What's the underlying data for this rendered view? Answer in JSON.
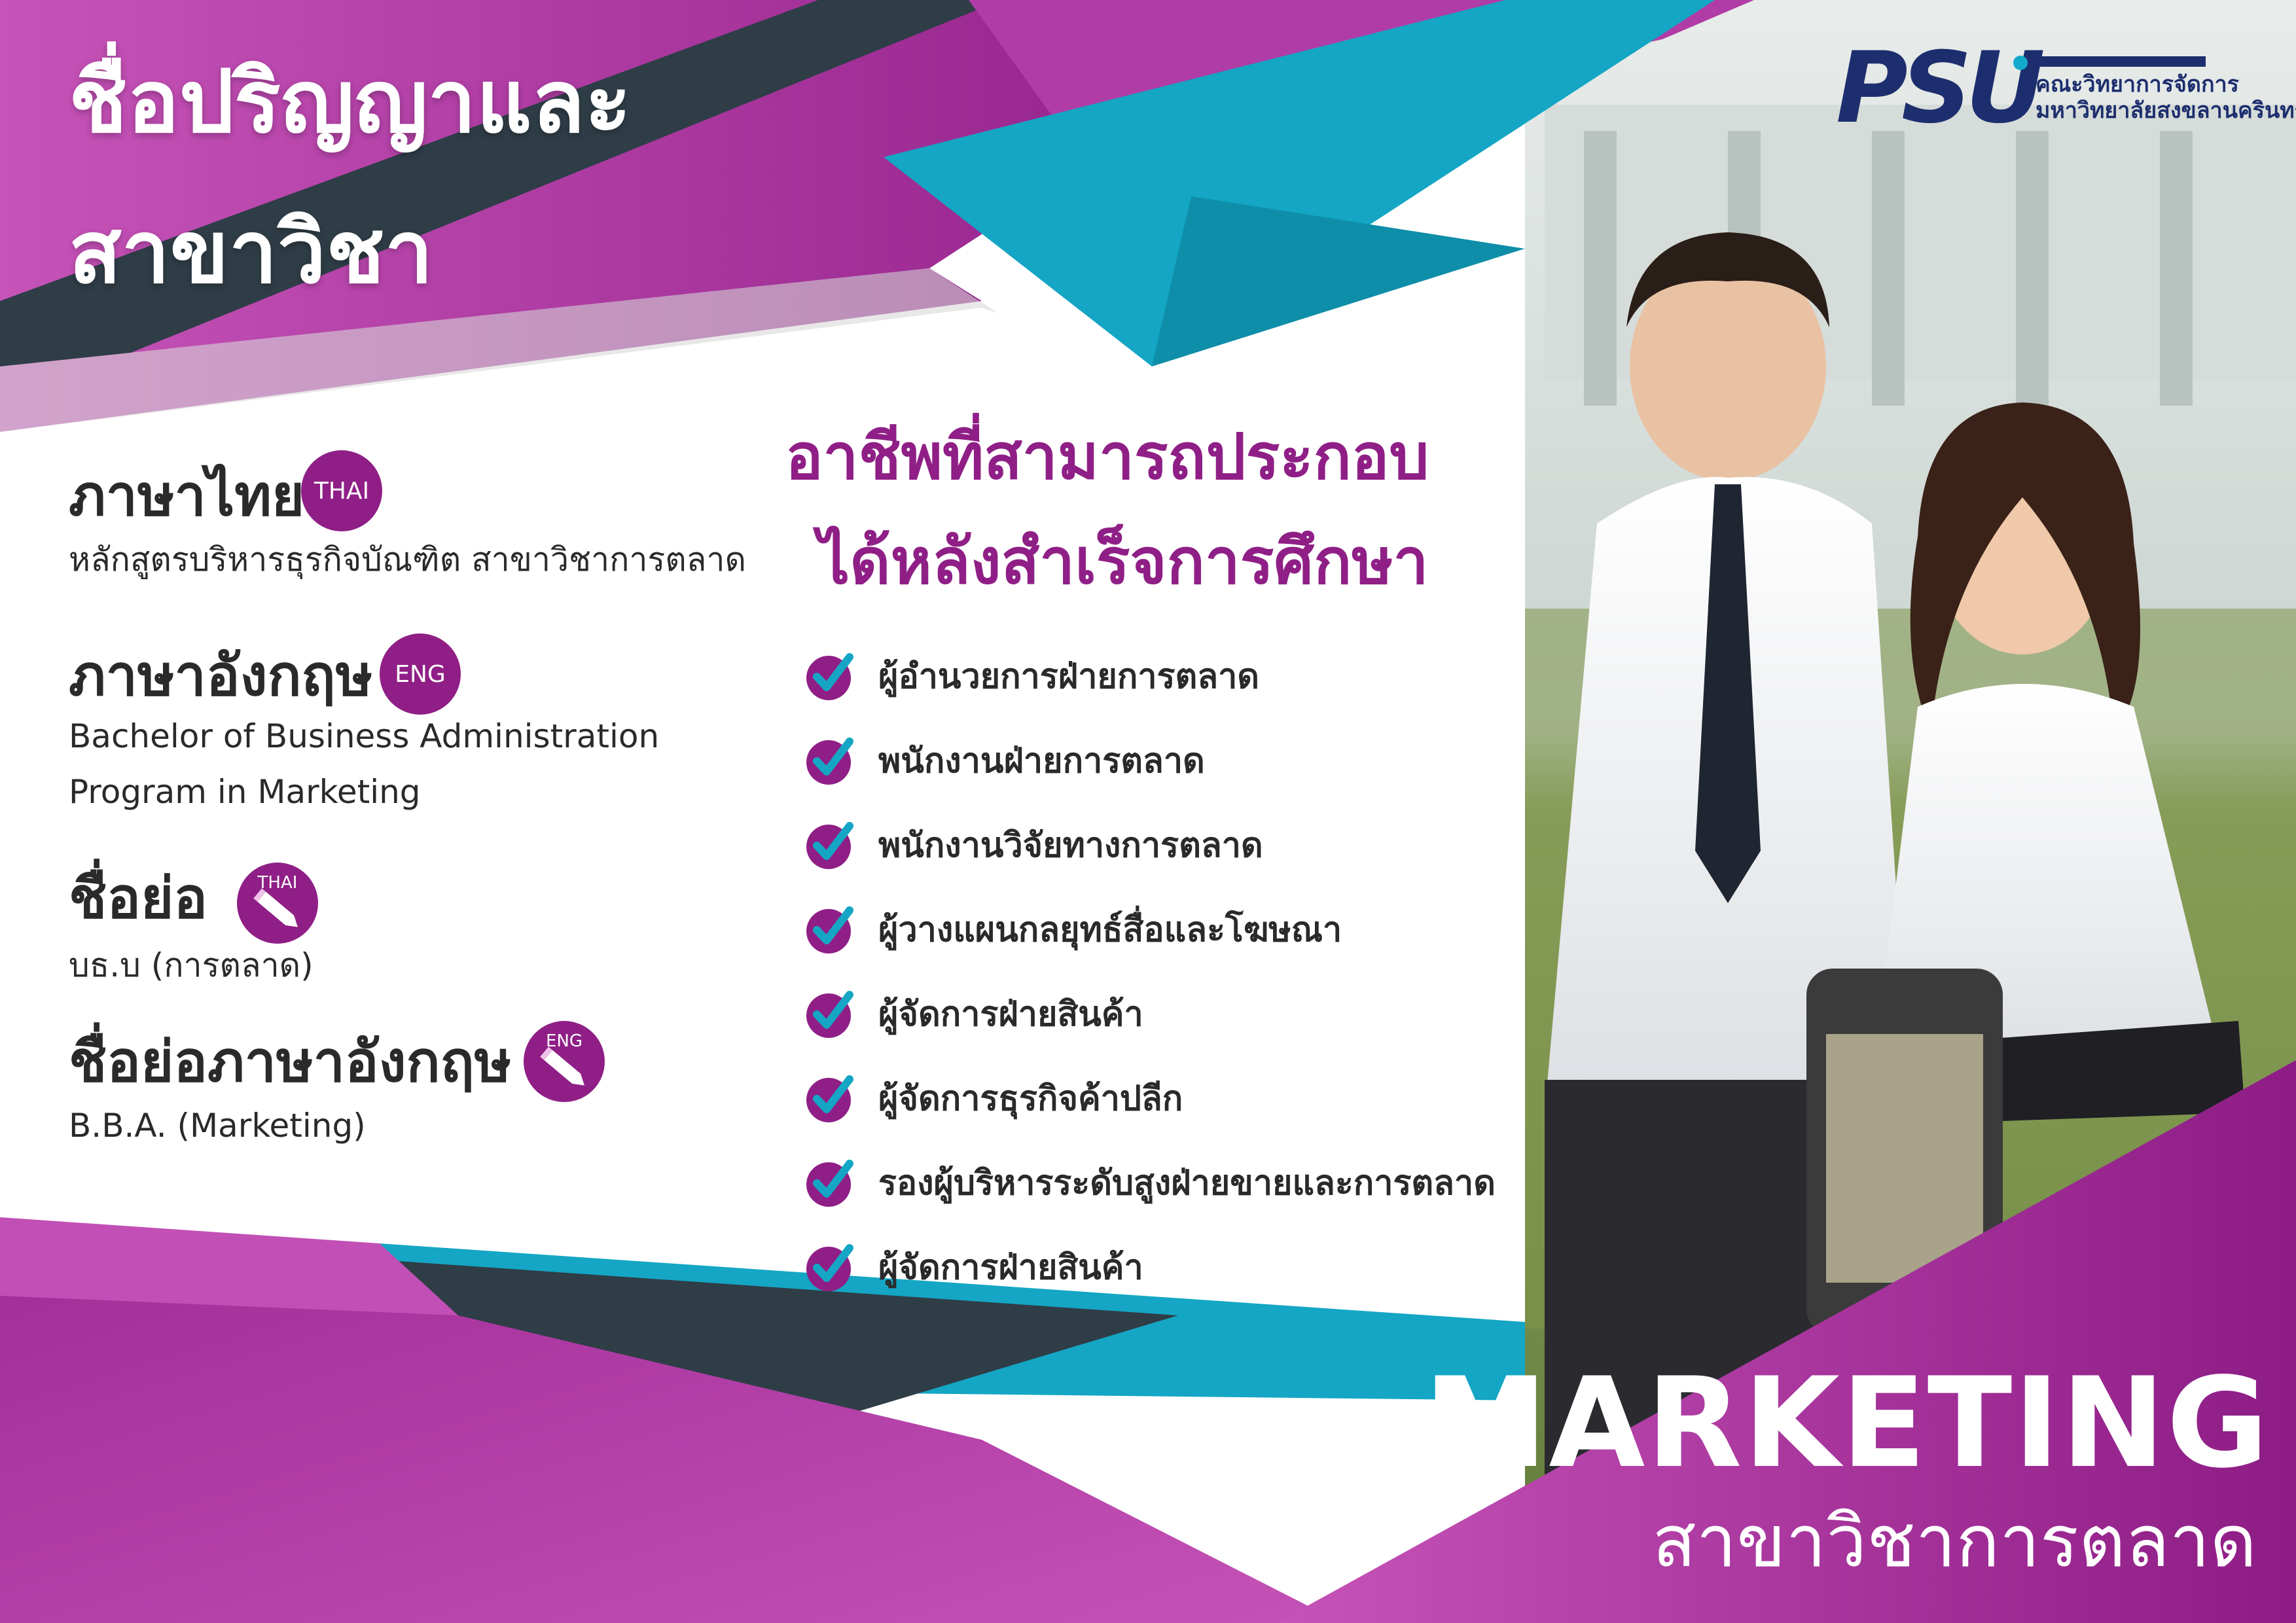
{
  "title": {
    "line1": "ชื่อปริญญาและ",
    "line2": "สาขาวิชา"
  },
  "logo": {
    "mark": "PSU",
    "line1": "คณะวิทยาการจัดการ",
    "line2": "มหาวิทยาลัยสงขลานครินทร์"
  },
  "sections": {
    "thai": {
      "heading": "ภาษาไทย",
      "badge": "THAI",
      "text": "หลักสูตรบริหารธุรกิจบัณฑิต สาขาวิชาการตลาด"
    },
    "eng": {
      "heading": "ภาษาอังกฤษ",
      "badge": "ENG",
      "line1": "Bachelor of Business Administration",
      "line2": "Program in Marketing"
    },
    "abbr_th": {
      "heading": "ชื่อย่อ",
      "badge": "THAI",
      "text": "บธ.บ (การตลาด)"
    },
    "abbr_en": {
      "heading": "ชื่อย่อภาษาอังกฤษ",
      "badge": "ENG",
      "text": "B.B.A. (Marketing)"
    }
  },
  "careers": {
    "title_line1": "อาชีพที่สามารถประกอบ",
    "title_line2": "ได้หลังสำเร็จการศึกษา",
    "items": [
      "ผู้อำนวยการฝ่ายการตลาด",
      "พนักงานฝ่ายการตลาด",
      "พนักงานวิจัยทางการตลาด",
      "ผู้วางแผนกลยุทธ์สื่อและโฆษณา",
      "ผู้จัดการฝ่ายสินค้า",
      "ผู้จัดการธุรกิจค้าปลีก",
      "รองผู้บริหารระดับสูงฝ่ายขายและการตลาด",
      "ผู้จัดการฝ่ายสินค้า"
    ]
  },
  "program": {
    "name_en": "MARKETING",
    "name_th": "สาขาวิชาการตลาด"
  },
  "colors": {
    "magenta": "#8f1f86",
    "magenta_light": "#c24fb5",
    "teal": "#14a6c4",
    "slate": "#2f3d47",
    "navy": "#1d2e6e"
  },
  "photo": {
    "description_icon": "students-photo"
  }
}
